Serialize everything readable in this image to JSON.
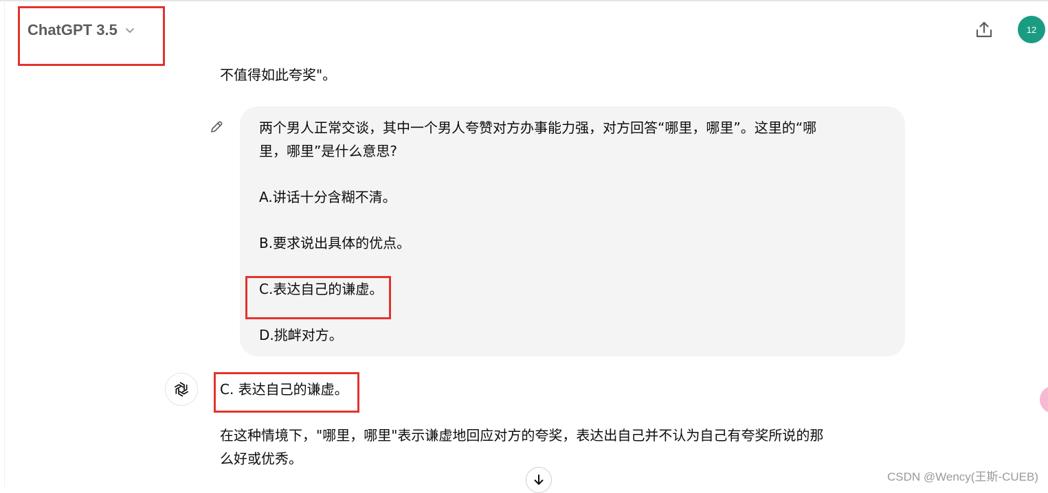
{
  "header": {
    "model_label": "ChatGPT 3.5",
    "avatar_text": "12"
  },
  "conversation": {
    "previous_text": "不值得如此夸奖\"。",
    "user_message": {
      "line1": "两个男人正常交谈，其中一个男人夸赞对方办事能力强，对方回答“哪里，哪里”。这里的“哪",
      "line2": "里，哪里”是什么意思?",
      "options": [
        "A.讲话十分含糊不清。",
        "B.要求说出具体的优点。",
        "C.表达自己的谦虚。",
        "D.挑衅对方。"
      ]
    },
    "assistant_answer": "C. 表达自己的谦虚。",
    "assistant_explain_line1": "在这种情境下，\"哪里，哪里\"表示谦虚地回应对方的夸奖，表达出自己并不认为自己有夸奖所说的那",
    "assistant_explain_line2": "么好或优秀。"
  },
  "watermark": "CSDN @Wency(王斯-CUEB)",
  "colors": {
    "highlight_box": "#e5322d",
    "avatar_bg": "#1a9c82",
    "bubble_bg": "#f4f4f4"
  },
  "icons": [
    "chevron-down-icon",
    "share-icon",
    "edit-icon",
    "openai-logo-icon",
    "arrow-down-icon"
  ]
}
